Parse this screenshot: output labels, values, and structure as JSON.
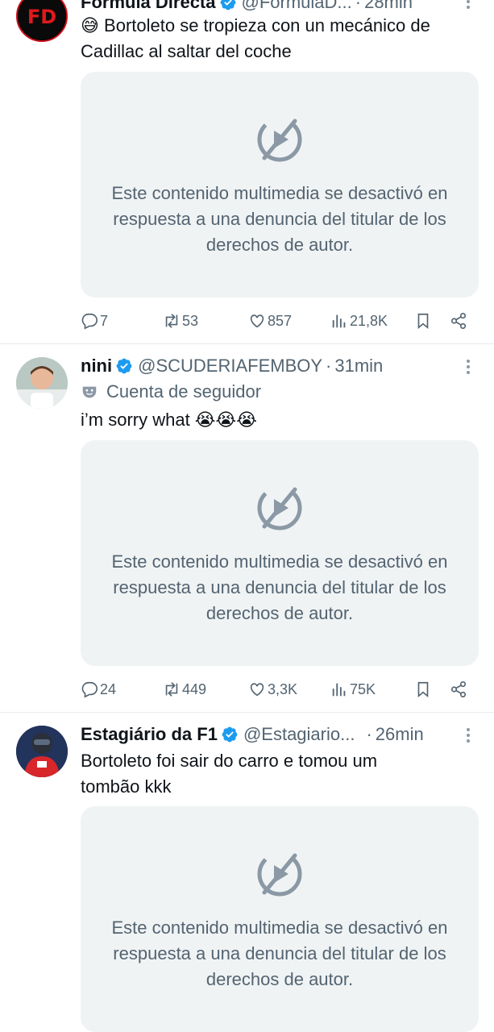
{
  "tweets": [
    {
      "name": "Fórmula Directa",
      "handle": "@FormulaD...",
      "separator": "·",
      "time": "28min",
      "avatar_initials": "FD",
      "text": "😅 Bortoleto se tropieza con un mecánico de Cadillac al saltar del coche",
      "media_message": "Este contenido multimedia se desactivó en respuesta a una denuncia del titular de los derechos de autor.",
      "replies": "7",
      "retweets": "53",
      "likes": "857",
      "views": "21,8K"
    },
    {
      "name": "nini",
      "handle": "@SCUDERIAFEMBOY",
      "separator": "·",
      "time": "31min",
      "badge": "Cuenta de seguidor",
      "text": "i’m sorry what 😭😭😭",
      "media_message": "Este contenido multimedia se desactivó en respuesta a una denuncia del titular de los derechos de autor.",
      "replies": "24",
      "retweets": "449",
      "likes": "3,3K",
      "views": "75K"
    },
    {
      "name": "Estagiário da F1",
      "handle": "@Estagiario...",
      "separator": "·",
      "time": "26min",
      "text": "Bortoleto foi sair do carro e tomou um tombão kkk",
      "media_message": "Este contenido multimedia se desactivó en respuesta a una denuncia del titular de los derechos de autor."
    }
  ],
  "colors": {
    "verified": "#1d9bf0",
    "muted_text": "#536471",
    "media_bg": "#f0f3f4",
    "fd_red": "#e0191c"
  },
  "icons": [
    "verified-badge-icon",
    "more-icon",
    "media-disabled-icon",
    "reply-icon",
    "retweet-icon",
    "like-icon",
    "views-icon",
    "bookmark-icon",
    "share-icon",
    "mask-icon"
  ]
}
